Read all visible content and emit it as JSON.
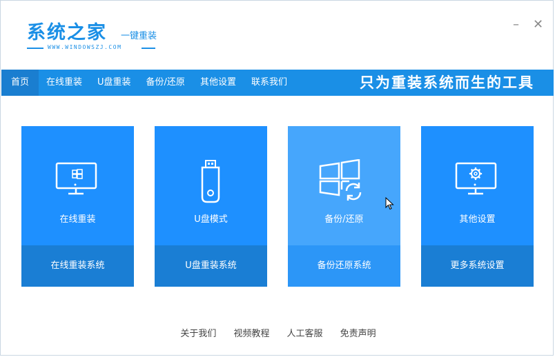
{
  "app": {
    "logo_main": "系统之家",
    "logo_sub": "一键重装",
    "logo_url": "WWW.WINDOWSZJ.COM"
  },
  "window_controls": {
    "minimize": "–",
    "close": "✕"
  },
  "nav": {
    "items": [
      {
        "label": "首页",
        "active": true
      },
      {
        "label": "在线重装"
      },
      {
        "label": "U盘重装"
      },
      {
        "label": "备份/还原"
      },
      {
        "label": "其他设置"
      },
      {
        "label": "联系我们"
      }
    ],
    "slogan": "只为重装系统而生的工具"
  },
  "cards": [
    {
      "title": "在线重装",
      "action": "在线重装系统",
      "icon": "monitor-windows-icon"
    },
    {
      "title": "U盘模式",
      "action": "U盘重装系统",
      "icon": "usb-drive-icon"
    },
    {
      "title": "备份/还原",
      "action": "备份还原系统",
      "icon": "windows-restore-icon",
      "hovered": true
    },
    {
      "title": "其他设置",
      "action": "更多系统设置",
      "icon": "monitor-gear-icon"
    }
  ],
  "footer": {
    "links": [
      "关于我们",
      "视频教程",
      "人工客服",
      "免责声明"
    ]
  },
  "colors": {
    "brand": "#1a8fe6",
    "nav_bg": "#1a8fe6",
    "card_bg": "#1e90ff",
    "card_bottom_bg": "#1a7ed4",
    "card_hover_bg": "#46a6fc"
  }
}
